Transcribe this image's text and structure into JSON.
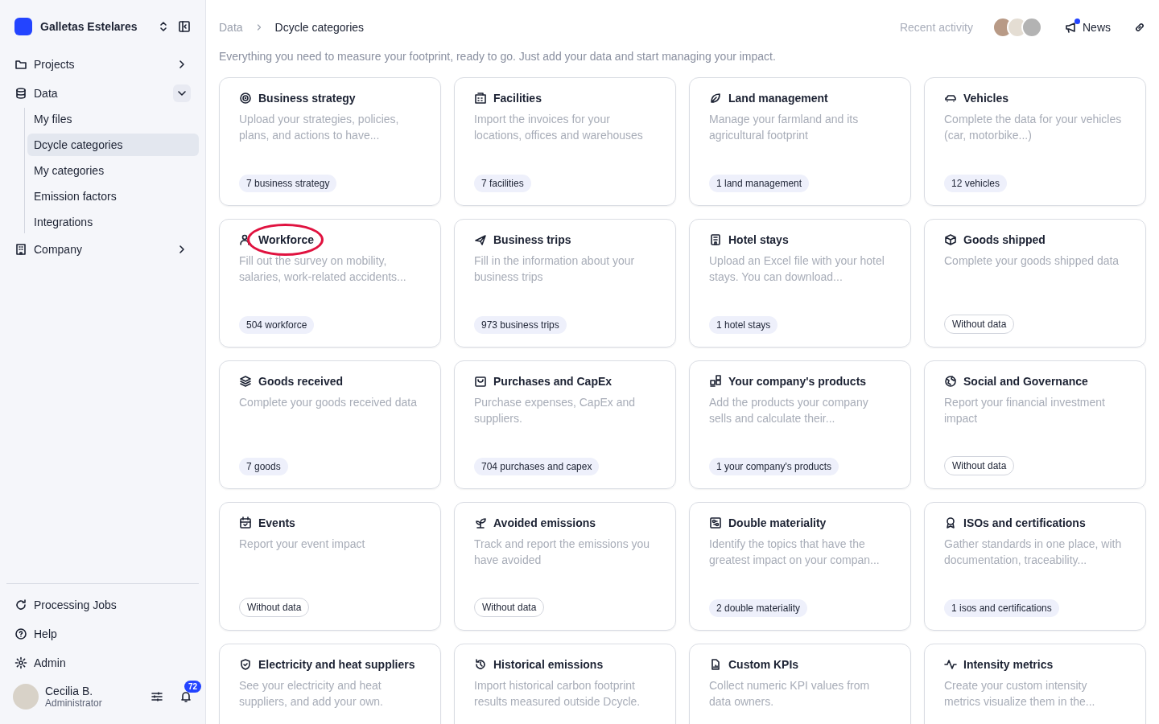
{
  "sidebar": {
    "org_name": "Galletas Estelares",
    "items": [
      {
        "label": "Projects",
        "expanded": false
      },
      {
        "label": "Data",
        "expanded": true,
        "children": [
          {
            "label": "My files",
            "selected": false
          },
          {
            "label": "Dcycle categories",
            "selected": true
          },
          {
            "label": "My categories",
            "selected": false
          },
          {
            "label": "Emission factors",
            "selected": false
          },
          {
            "label": "Integrations",
            "selected": false
          }
        ]
      },
      {
        "label": "Company",
        "expanded": false
      }
    ],
    "bottom_items": [
      {
        "label": "Processing Jobs"
      },
      {
        "label": "Help"
      },
      {
        "label": "Admin"
      }
    ],
    "user": {
      "name": "Cecilia B.",
      "role": "Administrator",
      "notifications": "72"
    }
  },
  "header": {
    "breadcrumb": [
      "Data",
      "Dcycle categories"
    ],
    "recent_activity": "Recent activity",
    "news": {
      "label": "News",
      "unread": true
    }
  },
  "intro": "Everything you need to measure your footprint, ready to go. Just add your data and start managing your impact.",
  "cards": [
    {
      "title": "Business strategy",
      "description": "Upload your strategies, policies, plans, and actions to have...",
      "badge": "7 business strategy",
      "has_data": true,
      "highlighted": false
    },
    {
      "title": "Facilities",
      "description": "Import the invoices for your locations, offices and warehouses",
      "badge": "7 facilities",
      "has_data": true,
      "highlighted": false
    },
    {
      "title": "Land management",
      "description": "Manage your farmland and its agricultural footprint",
      "badge": "1 land management",
      "has_data": true,
      "highlighted": false
    },
    {
      "title": "Vehicles",
      "description": "Complete the data for your vehicles (car, motorbike...)",
      "badge": "12 vehicles",
      "has_data": true,
      "highlighted": false
    },
    {
      "title": "Workforce",
      "description": "Fill out the survey on mobility, salaries, work-related accidents...",
      "badge": "504 workforce",
      "has_data": true,
      "highlighted": true
    },
    {
      "title": "Business trips",
      "description": "Fill in the information about your business trips",
      "badge": "973 business trips",
      "has_data": true,
      "highlighted": false
    },
    {
      "title": "Hotel stays",
      "description": "Upload an Excel file with your hotel stays. You can download...",
      "badge": "1 hotel stays",
      "has_data": true,
      "highlighted": false
    },
    {
      "title": "Goods shipped",
      "description": "Complete your goods shipped data",
      "badge": "Without data",
      "has_data": false,
      "highlighted": false
    },
    {
      "title": "Goods received",
      "description": "Complete your goods received data",
      "badge": "7 goods",
      "has_data": true,
      "highlighted": false
    },
    {
      "title": "Purchases and CapEx",
      "description": "Purchase expenses, CapEx and suppliers.",
      "badge": "704 purchases and capex",
      "has_data": true,
      "highlighted": false
    },
    {
      "title": "Your company's products",
      "description": "Add the products your company sells and calculate their...",
      "badge": "1 your company's products",
      "has_data": true,
      "highlighted": false
    },
    {
      "title": "Social and Governance",
      "description": "Report your financial investment impact",
      "badge": "Without data",
      "has_data": false,
      "highlighted": false
    },
    {
      "title": "Events",
      "description": "Report your event impact",
      "badge": "Without data",
      "has_data": false,
      "highlighted": false
    },
    {
      "title": "Avoided emissions",
      "description": "Track and report the emissions you have avoided",
      "badge": "Without data",
      "has_data": false,
      "highlighted": false
    },
    {
      "title": "Double materiality",
      "description": "Identify the topics that have the greatest impact on your compan...",
      "badge": "2 double materiality",
      "has_data": true,
      "highlighted": false
    },
    {
      "title": "ISOs and certifications",
      "description": "Gather standards in one place, with documentation, traceability...",
      "badge": "1 isos and certifications",
      "has_data": true,
      "highlighted": false
    },
    {
      "title": "Electricity and heat suppliers",
      "description": "See your electricity and heat suppliers, and add your own.",
      "highlighted": false
    },
    {
      "title": "Historical emissions",
      "description": "Import historical carbon footprint results measured outside Dcycle.",
      "highlighted": false
    },
    {
      "title": "Custom KPIs",
      "description": "Collect numeric KPI values from data owners.",
      "highlighted": false
    },
    {
      "title": "Intensity metrics",
      "description": "Create your custom intensity metrics visualize them in the...",
      "highlighted": false
    }
  ]
}
